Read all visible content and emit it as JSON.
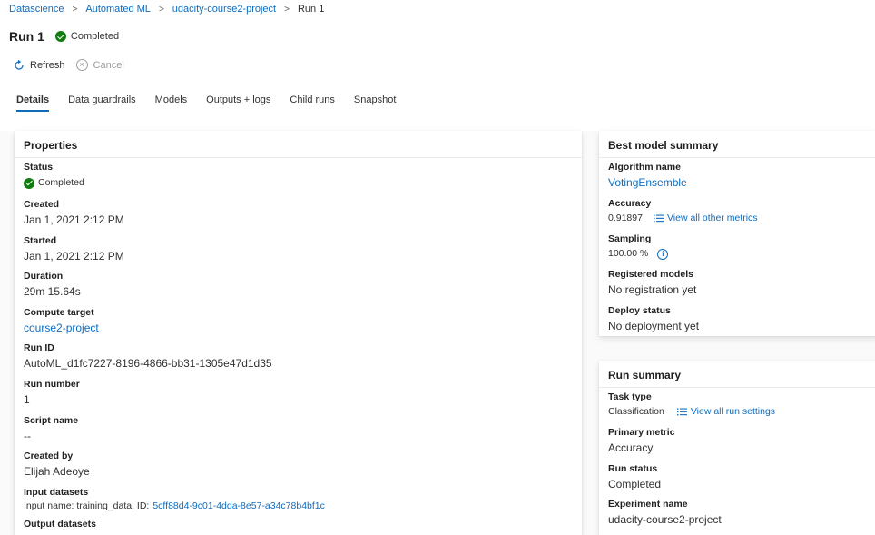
{
  "breadcrumb": {
    "items": [
      "Datascience",
      "Automated ML",
      "udacity-course2-project"
    ],
    "current": "Run 1",
    "separator": ">"
  },
  "header": {
    "title": "Run 1",
    "status": "Completed"
  },
  "toolbar": {
    "refresh_label": "Refresh",
    "cancel_label": "Cancel"
  },
  "tabs": [
    {
      "label": "Details",
      "active": true
    },
    {
      "label": "Data guardrails"
    },
    {
      "label": "Models"
    },
    {
      "label": "Outputs + logs"
    },
    {
      "label": "Child runs"
    },
    {
      "label": "Snapshot"
    }
  ],
  "properties": {
    "title": "Properties",
    "status_label": "Status",
    "status_value": "Completed",
    "created_label": "Created",
    "created_value": "Jan 1, 2021 2:12 PM",
    "started_label": "Started",
    "started_value": "Jan 1, 2021 2:12 PM",
    "duration_label": "Duration",
    "duration_value": "29m 15.64s",
    "compute_label": "Compute target",
    "compute_value": "course2-project",
    "runid_label": "Run ID",
    "runid_value": "AutoML_d1fc7227-8196-4866-bb31-1305e47d1d35",
    "runnumber_label": "Run number",
    "runnumber_value": "1",
    "script_label": "Script name",
    "script_value": "--",
    "createdby_label": "Created by",
    "createdby_value": "Elijah Adeoye",
    "inputds_label": "Input datasets",
    "inputds_prefix": "Input name: training_data, ID:",
    "inputds_id": "5cff88d4-9c01-4dda-8e57-a34c78b4bf1c",
    "outputds_label": "Output datasets"
  },
  "best_model": {
    "title": "Best model summary",
    "algo_label": "Algorithm name",
    "algo_value": "VotingEnsemble",
    "accuracy_label": "Accuracy",
    "accuracy_value": "0.91897",
    "metrics_link": "View all other metrics",
    "sampling_label": "Sampling",
    "sampling_value": "100.00 %",
    "registered_label": "Registered models",
    "registered_value": "No registration yet",
    "deploy_label": "Deploy status",
    "deploy_value": "No deployment yet"
  },
  "run_summary": {
    "title": "Run summary",
    "task_label": "Task type",
    "task_value": "Classification",
    "settings_link": "View all run settings",
    "metric_label": "Primary metric",
    "metric_value": "Accuracy",
    "runstatus_label": "Run status",
    "runstatus_value": "Completed",
    "experiment_label": "Experiment name",
    "experiment_value": "udacity-course2-project"
  },
  "colors": {
    "accent": "#0f6cbd",
    "success": "#107c10",
    "text": "#323130"
  }
}
